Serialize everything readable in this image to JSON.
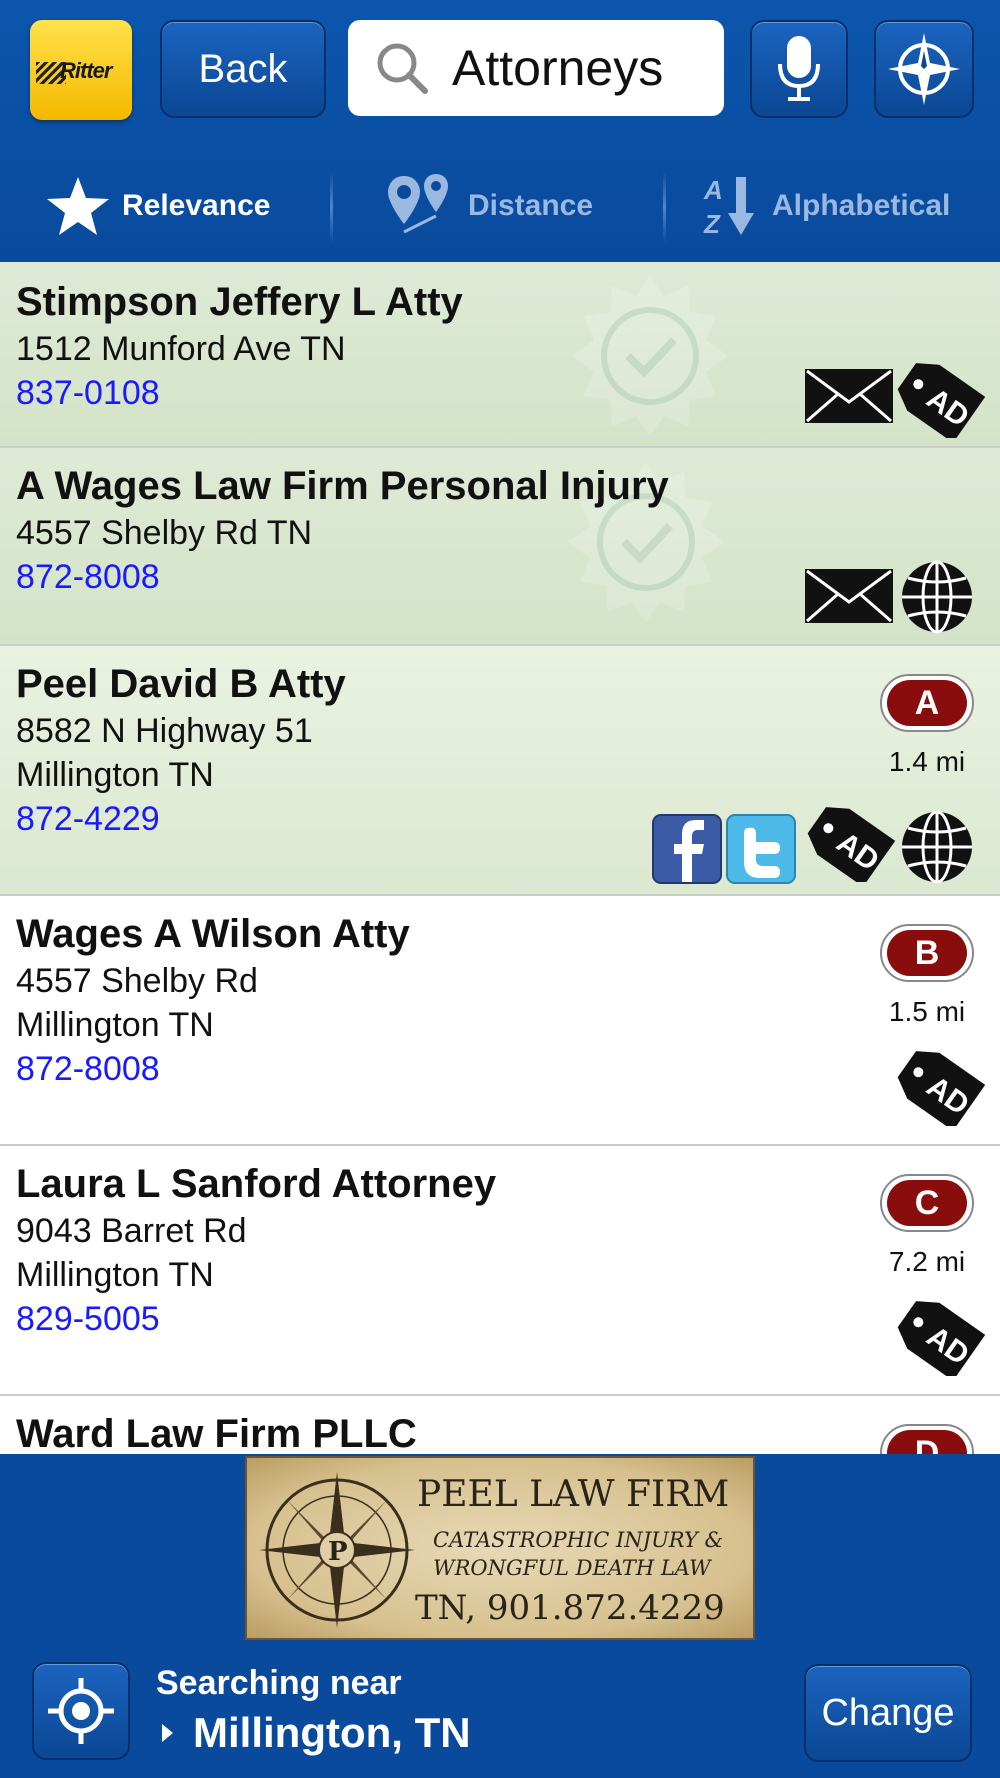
{
  "header": {
    "logo_text": "Ritter",
    "back_label": "Back",
    "search_query": "Attorneys"
  },
  "sort_tabs": [
    {
      "label": "Relevance",
      "active": true
    },
    {
      "label": "Distance",
      "active": false
    },
    {
      "label": "Alphabetical",
      "active": false
    }
  ],
  "results": [
    {
      "name": "Stimpson Jeffery L Atty",
      "address": "1512 Munford Ave TN",
      "city": "",
      "phone": "837-0108",
      "badge": "",
      "distance": "",
      "icons": [
        "mail-icon",
        "ad-tag-icon"
      ]
    },
    {
      "name": "A Wages Law Firm Personal Injury",
      "address": "4557 Shelby Rd TN",
      "city": "",
      "phone": "872-8008",
      "badge": "",
      "distance": "",
      "icons": [
        "mail-icon",
        "globe-icon"
      ]
    },
    {
      "name": "Peel David B Atty",
      "address": "8582 N Highway 51",
      "city": "Millington TN",
      "phone": "872-4229",
      "badge": "A",
      "distance": "1.4 mi",
      "icons": [
        "facebook-icon",
        "twitter-icon",
        "ad-tag-icon",
        "globe-icon"
      ]
    },
    {
      "name": "Wages A Wilson Atty",
      "address": "4557 Shelby Rd",
      "city": "Millington TN",
      "phone": "872-8008",
      "badge": "B",
      "distance": "1.5 mi",
      "icons": [
        "ad-tag-icon"
      ]
    },
    {
      "name": "Laura L Sanford Attorney",
      "address": "9043 Barret Rd",
      "city": "Millington TN",
      "phone": "829-5005",
      "badge": "C",
      "distance": "7.2 mi",
      "icons": [
        "ad-tag-icon"
      ]
    },
    {
      "name": "Ward Law Firm PLLC",
      "address": "",
      "city": "",
      "phone": "",
      "badge": "D",
      "distance": "",
      "icons": []
    }
  ],
  "banner": {
    "firm": "PEEL LAW FIRM",
    "line1": "CATASTROPHIC INJURY &",
    "line2": "WRONGFUL DEATH LAW",
    "phone": "TN, 901.872.4229"
  },
  "footer": {
    "searching_label": "Searching near",
    "location": "Millington, TN",
    "change_label": "Change"
  }
}
